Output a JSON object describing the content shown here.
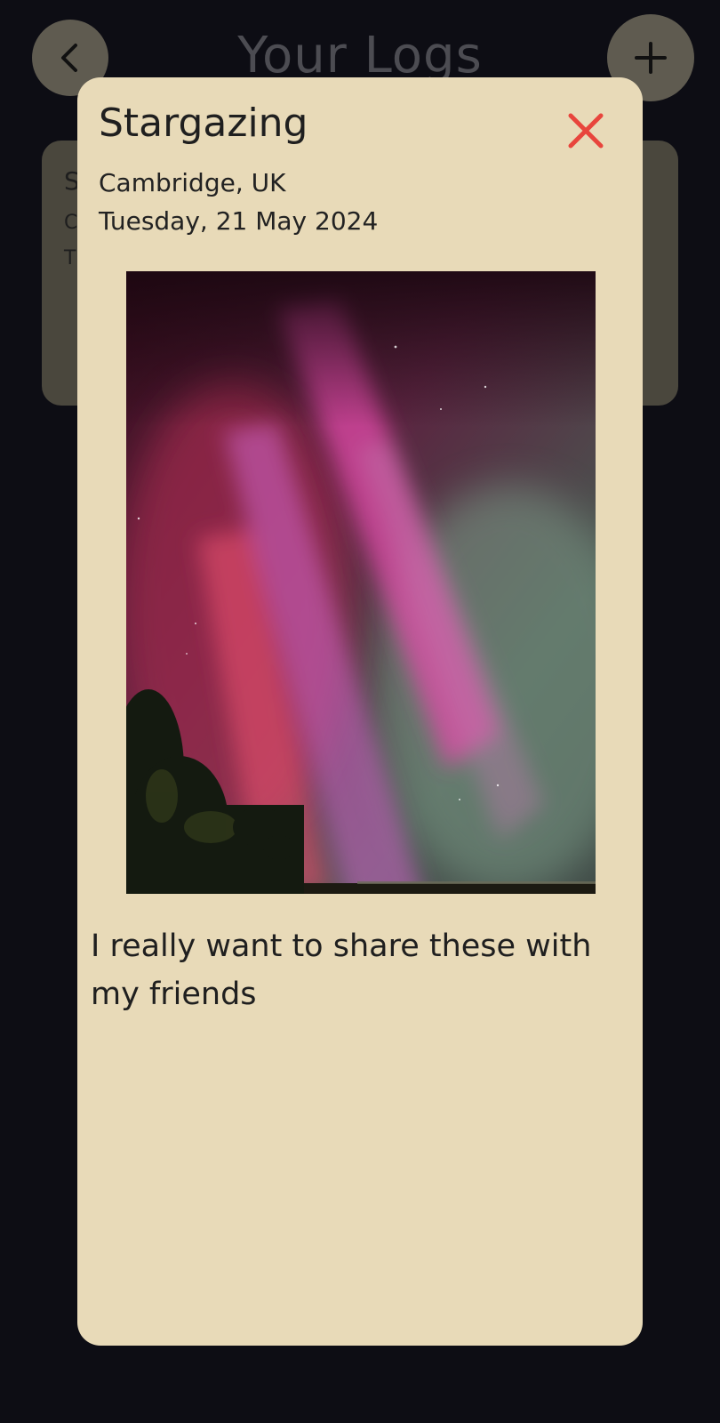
{
  "background": {
    "title": "Your Logs",
    "card_peek": [
      "S",
      "C",
      "T"
    ],
    "icons": {
      "back": "chevron-left-icon",
      "add": "plus-icon"
    }
  },
  "modal": {
    "title": "Stargazing",
    "location": "Cambridge, UK",
    "date": "Tuesday, 21 May 2024",
    "note": "I really want to share these with my friends",
    "photo_subject": "aurora-photo",
    "close_icon": "close-icon"
  },
  "colors": {
    "page_bg": "#0d0d14",
    "modal_bg": "#e8dab8",
    "close_red": "#e8453c",
    "dim_button": "#5f5b50"
  }
}
